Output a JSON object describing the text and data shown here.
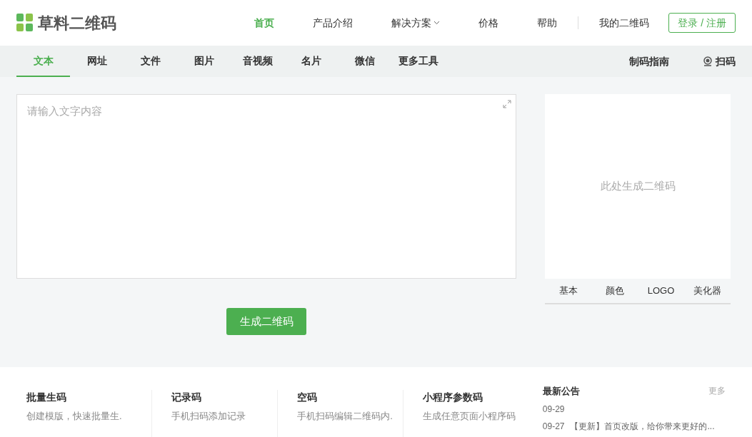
{
  "header": {
    "logo": "草料二维码",
    "nav": [
      {
        "label": "首页",
        "selected": true,
        "has_menu": false
      },
      {
        "label": "产品介绍",
        "selected": false,
        "has_menu": false
      },
      {
        "label": "解决方案",
        "selected": false,
        "has_menu": true
      },
      {
        "label": "价格",
        "selected": false,
        "has_menu": false
      },
      {
        "label": "帮助",
        "selected": false,
        "has_menu": false
      }
    ],
    "my_codes": "我的二维码",
    "login": "登录 / 注册"
  },
  "tabs": [
    {
      "label": "文本",
      "selected": true
    },
    {
      "label": "网址",
      "selected": false
    },
    {
      "label": "文件",
      "selected": false
    },
    {
      "label": "图片",
      "selected": false
    },
    {
      "label": "音视频",
      "selected": false
    },
    {
      "label": "名片",
      "selected": false
    },
    {
      "label": "微信",
      "selected": false
    },
    {
      "label": "更多工具",
      "selected": false
    }
  ],
  "tabs_right": {
    "guide": "制码指南",
    "scan": "扫码"
  },
  "editor": {
    "placeholder": "请输入文字内容"
  },
  "generate_button": "生成二维码",
  "preview": {
    "placeholder": "此处生成二维码",
    "tabs": [
      {
        "label": "基本",
        "selected": false
      },
      {
        "label": "颜色",
        "selected": false
      },
      {
        "label": "LOGO",
        "selected": false
      },
      {
        "label": "美化器",
        "selected": false
      }
    ]
  },
  "features": [
    {
      "title": "批量生码",
      "desc": "创建模版，快速批量生."
    },
    {
      "title": "记录码",
      "desc": "手机扫码添加记录"
    },
    {
      "title": "空码",
      "desc": "手机扫码编辑二维码内."
    },
    {
      "title": "小程序参数码",
      "desc": "生成任意页面小程序码"
    }
  ],
  "announcements": {
    "title": "最新公告",
    "more": "更多",
    "items": [
      {
        "date": "09-29"
      },
      {
        "date": "09-27",
        "text": "【更新】首页改版，给你带来更好的..."
      }
    ]
  }
}
